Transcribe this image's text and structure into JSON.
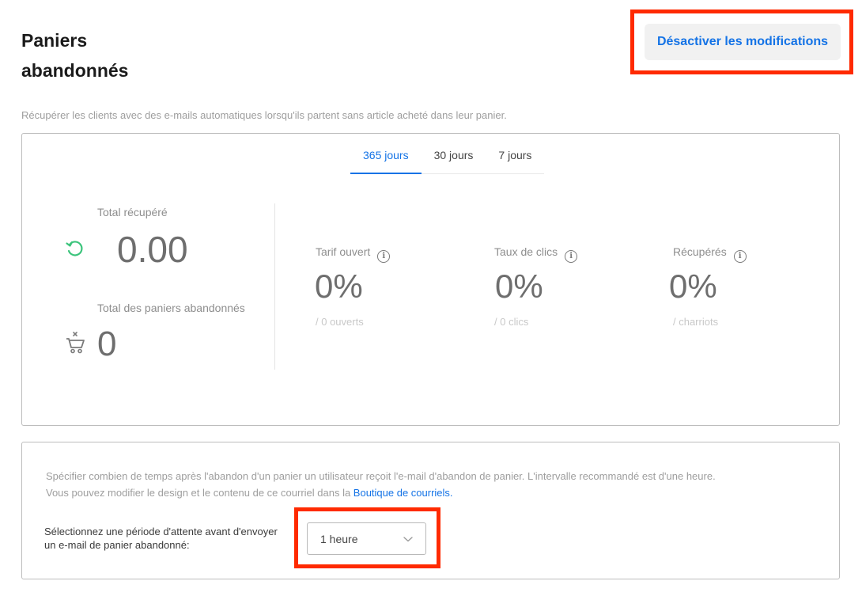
{
  "header": {
    "title_line1": "Paniers",
    "title_line2": "abandonnés",
    "action_label": "Désactiver les modifications"
  },
  "subtitle": "Récupérer les clients avec des e-mails automatiques lorsqu'ils partent sans article acheté dans leur panier.",
  "tabs": [
    {
      "label": "365 jours",
      "active": true
    },
    {
      "label": "30 jours",
      "active": false
    },
    {
      "label": "7 jours",
      "active": false
    }
  ],
  "stats": {
    "total_recovered": {
      "label": "Total récupéré",
      "value": "0.00",
      "icon": "refresh-icon"
    },
    "total_abandoned": {
      "label": "Total des paniers abandonnés",
      "value": "0",
      "icon": "cart-remove-icon"
    },
    "metrics": [
      {
        "label": "Tarif ouvert",
        "value": "0%",
        "sub": "/ 0 ouverts",
        "icon": "info-icon"
      },
      {
        "label": "Taux de clics",
        "value": "0%",
        "sub": "/ 0 clics",
        "icon": "info-icon"
      },
      {
        "label": "Récupérés",
        "value": "0%",
        "sub": "/ charriots",
        "icon": "info-icon"
      }
    ]
  },
  "settings": {
    "description_line1": "Spécifier combien de temps après l'abandon d'un panier un utilisateur reçoit l'e-mail d'abandon de panier. L'intervalle recommandé est d'une heure.",
    "description_line2_prefix": "Vous pouvez modifier le design et le contenu de ce courriel dans la ",
    "description_link": "Boutique de courriels.",
    "period_label": "Sélectionnez une période d'attente avant d'envoyer un e-mail de panier abandonné:",
    "period_value": "1 heure"
  },
  "colors": {
    "accent": "#1473e6",
    "highlight": "#ff2a00",
    "recovered_icon": "#3cc47c"
  }
}
